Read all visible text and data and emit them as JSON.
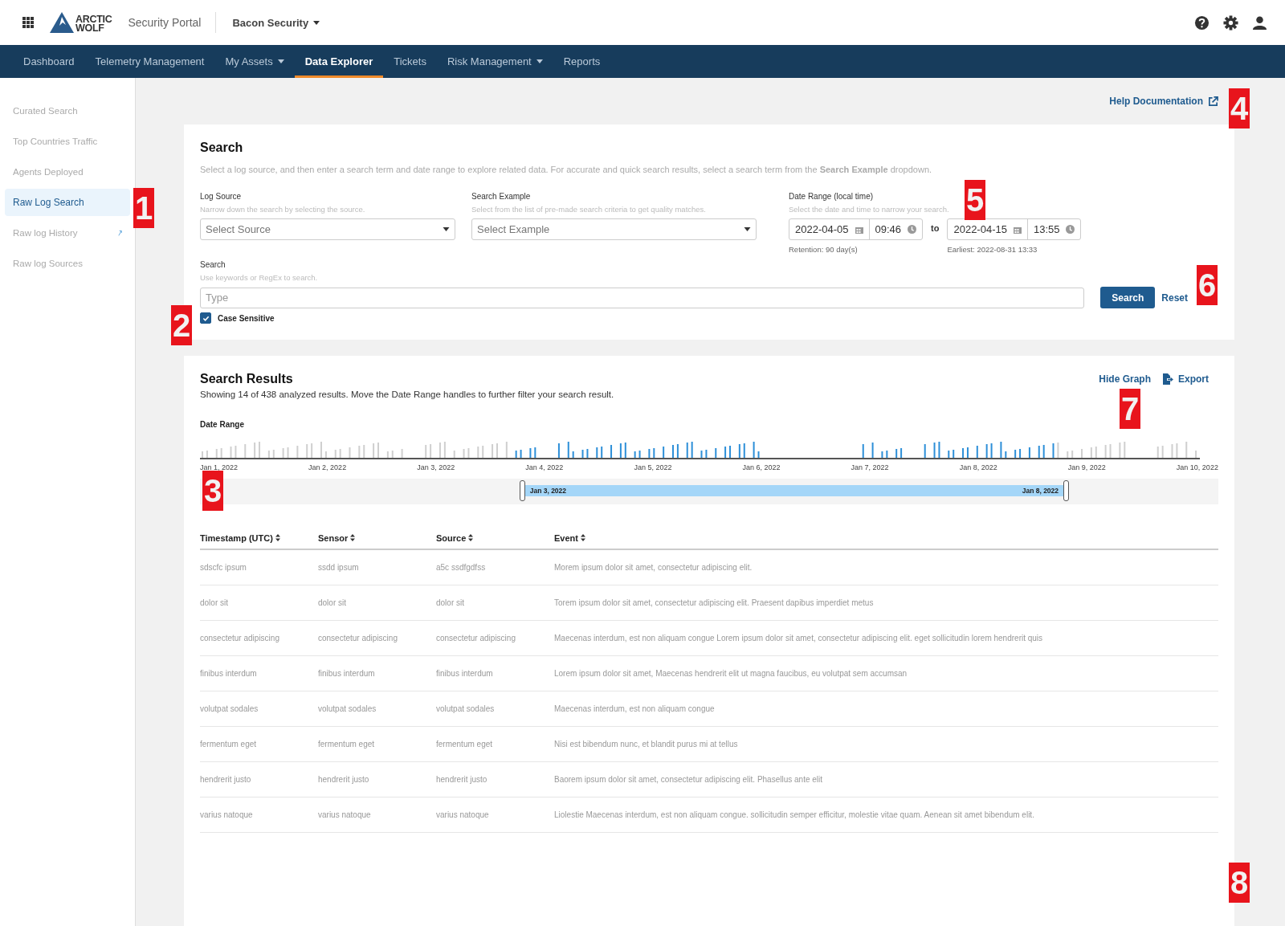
{
  "header": {
    "logo_text": [
      "ARCTIC",
      "WOLF"
    ],
    "portal": "Security Portal",
    "org": "Bacon Security"
  },
  "nav": [
    {
      "label": "Dashboard",
      "selected": false,
      "dropdown": false
    },
    {
      "label": "Telemetry Management",
      "selected": false,
      "dropdown": false
    },
    {
      "label": "My Assets",
      "selected": false,
      "dropdown": true
    },
    {
      "label": "Data Explorer",
      "selected": true,
      "dropdown": false
    },
    {
      "label": "Tickets",
      "selected": false,
      "dropdown": false
    },
    {
      "label": "Risk Management",
      "selected": false,
      "dropdown": true
    },
    {
      "label": "Reports",
      "selected": false,
      "dropdown": false
    }
  ],
  "sidebar": {
    "items": [
      {
        "label": "Curated Search",
        "selected": false,
        "external": false
      },
      {
        "label": "Top Countries Traffic",
        "selected": false,
        "external": false
      },
      {
        "label": "Agents Deployed",
        "selected": false,
        "external": false
      },
      {
        "label": "Raw Log Search",
        "selected": true,
        "external": false
      },
      {
        "label": "Raw log History",
        "selected": false,
        "external": true
      },
      {
        "label": "Raw log  Sources",
        "selected": false,
        "external": false
      }
    ]
  },
  "help_link": "Help Documentation",
  "search_panel": {
    "title": "Search",
    "description": "Select a log source, and then enter a search term and date range to explore related data. For accurate and quick search results, select a search term from the **Search Example** dropdown.",
    "log_source": {
      "label": "Log Source",
      "hint": "Narrow down the search by selecting the source.",
      "placeholder": "Select Source"
    },
    "search_example": {
      "label": "Search Example",
      "hint": "Select from the list of pre-made search criteria to get quality matches.",
      "placeholder": "Select Example"
    },
    "date_range": {
      "label": "Date Range (local time)",
      "hint": "Select the date and time to narrow your search.",
      "from_date": "2022-04-05",
      "from_time": "09:46",
      "separator": "to",
      "to_date": "2022-04-15",
      "to_time": "13:55",
      "from_note": "Retention: 90 day(s)",
      "to_note": "Earliest: 2022-08-31 13:33"
    },
    "search": {
      "label": "Search",
      "hint": "Use keywords or RegEx to search.",
      "placeholder": "Type"
    },
    "case_sensitive": {
      "label": "Case Sensitive",
      "checked": true
    },
    "buttons": {
      "search": "Search",
      "reset": "Reset"
    }
  },
  "results": {
    "title": "Search Results",
    "summary": "Showing 14 of 438 analyzed results. Move the Date Range handles to further filter your search result.",
    "hide_graph": "Hide Graph",
    "export": "Export",
    "date_range_label": "Date Range",
    "axis_labels": [
      "Jan 1, 2022",
      "Jan 2, 2022",
      "Jan 3, 2022",
      "Jan 4, 2022",
      "Jan 5, 2022",
      "Jan 6, 2022",
      "Jan 7, 2022",
      "Jan 8, 2022",
      "Jan 9, 2022",
      "Jan 10, 2022"
    ],
    "range_start": "Jan 3, 2022",
    "range_end": "Jan 8, 2022",
    "columns": [
      "Timestamp (UTC)",
      "Sensor",
      "Source",
      "Event"
    ],
    "rows": [
      [
        "sdscfc ipsum",
        "ssdd ipsum",
        "a5c ssdfgdfss",
        "Morem ipsum dolor sit amet, consectetur adipiscing elit."
      ],
      [
        "dolor sit",
        "dolor sit",
        "dolor sit",
        "Torem ipsum dolor sit amet, consectetur adipiscing elit. Praesent dapibus imperdiet metus"
      ],
      [
        "consectetur adipiscing",
        "consectetur adipiscing",
        "consectetur adipiscing",
        "Maecenas interdum, est non aliquam congue Lorem ipsum dolor sit amet, consectetur adipiscing elit. eget sollicitudin lorem hendrerit quis"
      ],
      [
        "finibus interdum",
        "finibus interdum",
        "finibus interdum",
        "Lorem ipsum dolor sit amet, Maecenas hendrerit elit ut magna faucibus, eu volutpat sem accumsan"
      ],
      [
        "volutpat sodales",
        "volutpat sodales",
        "volutpat sodales",
        "Maecenas interdum, est non aliquam congue"
      ],
      [
        "fermentum eget",
        "fermentum eget",
        "fermentum eget",
        "Nisi est bibendum nunc, et blandit purus mi at tellus"
      ],
      [
        "hendrerit justo",
        "hendrerit justo",
        "hendrerit justo",
        "Baorem ipsum dolor sit amet, consectetur adipiscing elit. Phasellus ante elit"
      ],
      [
        "varius natoque",
        "varius natoque",
        "varius natoque",
        "Liolestie Maecenas interdum, est non aliquam congue. sollicitudin semper efficitur, molestie vitae quam. Aenean sit amet bibendum elit."
      ]
    ]
  },
  "callouts": [
    "1",
    "2",
    "3",
    "4",
    "5",
    "6",
    "7",
    "8"
  ]
}
